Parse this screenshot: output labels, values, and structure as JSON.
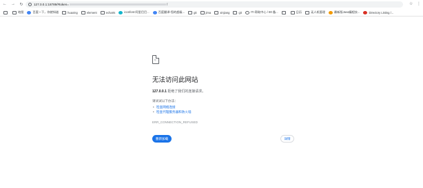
{
  "browser": {
    "back_icon": "back-arrow-icon",
    "forward_icon": "forward-arrow-icon",
    "reload_icon": "reload-icon",
    "address": {
      "url_visible": "127.0.0.1:18789/#token=",
      "url_tail": "f"
    },
    "star_icon": "bookmark-star-icon",
    "menu_icon": "more-vert-icon"
  },
  "bookmarks": [
    {
      "label": "",
      "icon": "apps-icon"
    },
    {
      "label": "地图",
      "icon": "folder-icon"
    },
    {
      "label": "百度一下，你就知道",
      "icon": "baidu-icon"
    },
    {
      "label": "huaxing",
      "icon": "folder-icon"
    },
    {
      "label": "element",
      "icon": "folder-icon"
    },
    {
      "label": "echarts",
      "icon": "folder-icon"
    },
    {
      "label": "iconfont-阿里巴巴...",
      "icon": "iconfont-icon"
    },
    {
      "label": "百度翻译-您的超级...",
      "icon": "baidu-translate-icon"
    },
    {
      "label": "git",
      "icon": "folder-icon"
    },
    {
      "label": "jima",
      "icon": "folder-icon"
    },
    {
      "label": "xinjiang",
      "icon": "folder-icon"
    },
    {
      "label": "git",
      "icon": "folder-icon"
    },
    {
      "label": "ITI 帮助中心 / 80 备...",
      "icon": "iti-icon"
    },
    {
      "label": "",
      "icon": "folder-icon"
    },
    {
      "label": "日历",
      "icon": "folder-icon"
    },
    {
      "label": "无人机管理",
      "icon": "folder-icon"
    },
    {
      "label": "最新版Java编程技...",
      "icon": "java-icon"
    },
    {
      "label": "Directory Listing /...",
      "icon": "directory-icon"
    }
  ],
  "error_page": {
    "icon": "sad-document-icon",
    "title": "无法访问此网站",
    "host": "127.0.0.1",
    "description_rest": " 拒绝了我们的连接请求。",
    "try_label": "请试试以下办法：",
    "suggestions": [
      "检查网络连接",
      "检查代理服务器和防火墙"
    ],
    "error_code": "ERR_CONNECTION_REFUSED",
    "reload_label": "重新加载",
    "details_label": "详情"
  }
}
